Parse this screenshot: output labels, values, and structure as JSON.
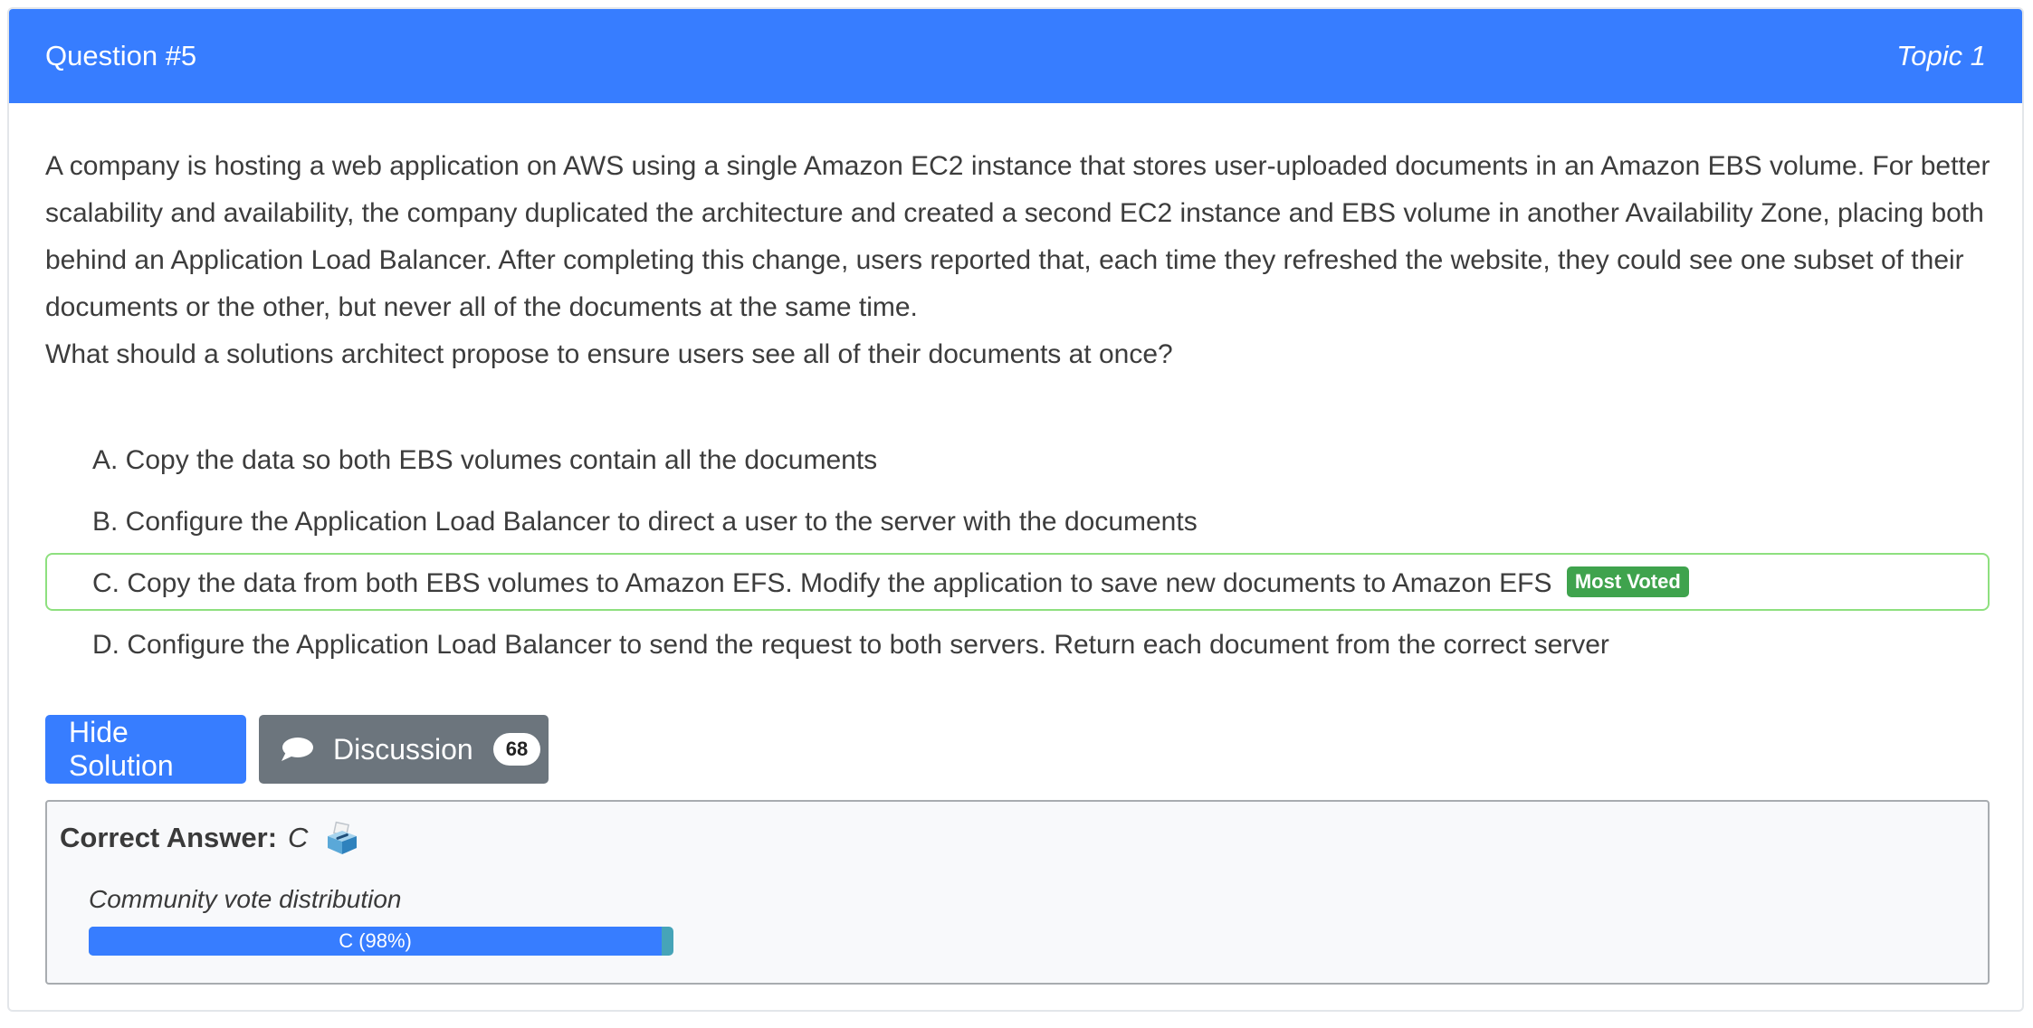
{
  "header": {
    "question_number": "Question #5",
    "topic": "Topic 1"
  },
  "question": {
    "paragraph_1": "A company is hosting a web application on AWS using a single Amazon EC2 instance that stores user-uploaded documents in an Amazon EBS volume. For better scalability and availability, the company duplicated the architecture and created a second EC2 instance and EBS volume in another Availability Zone, placing both behind an Application Load Balancer. After completing this change, users reported that, each time they refreshed the website, they could see one subset of their documents or the other, but never all of the documents at the same time.",
    "paragraph_2": "What should a solutions architect propose to ensure users see all of their documents at once?"
  },
  "choices": [
    {
      "text": "A. Copy the data so both EBS volumes contain all the documents"
    },
    {
      "text": "B. Configure the Application Load Balancer to direct a user to the server with the documents"
    },
    {
      "text": "C. Copy the data from both EBS volumes to Amazon EFS. Modify the application to save new documents to Amazon EFS",
      "badge": "Most Voted"
    },
    {
      "text": "D. Configure the Application Load Balancer to send the request to both servers. Return each document from the correct server"
    }
  ],
  "buttons": {
    "hide_solution": "Hide Solution",
    "discussion": "Discussion",
    "discussion_count": "68"
  },
  "answer": {
    "label": "Correct Answer:",
    "value": "C",
    "vote_label": "Community vote distribution",
    "vote_bar_text": "C (98%)",
    "vote_percent": 98
  },
  "colors": {
    "header": "#377dff",
    "primary_button": "#377dff",
    "secondary_button": "#6c757d",
    "most_voted_badge": "#3fa34d",
    "correct_choice_border": "#8ee07f",
    "vote_bar_fill": "#377dff",
    "vote_bar_remainder": "#46a4b8"
  },
  "icons": {
    "discussion": "chat-bubble-icon",
    "answer": "ballot-box-icon"
  }
}
